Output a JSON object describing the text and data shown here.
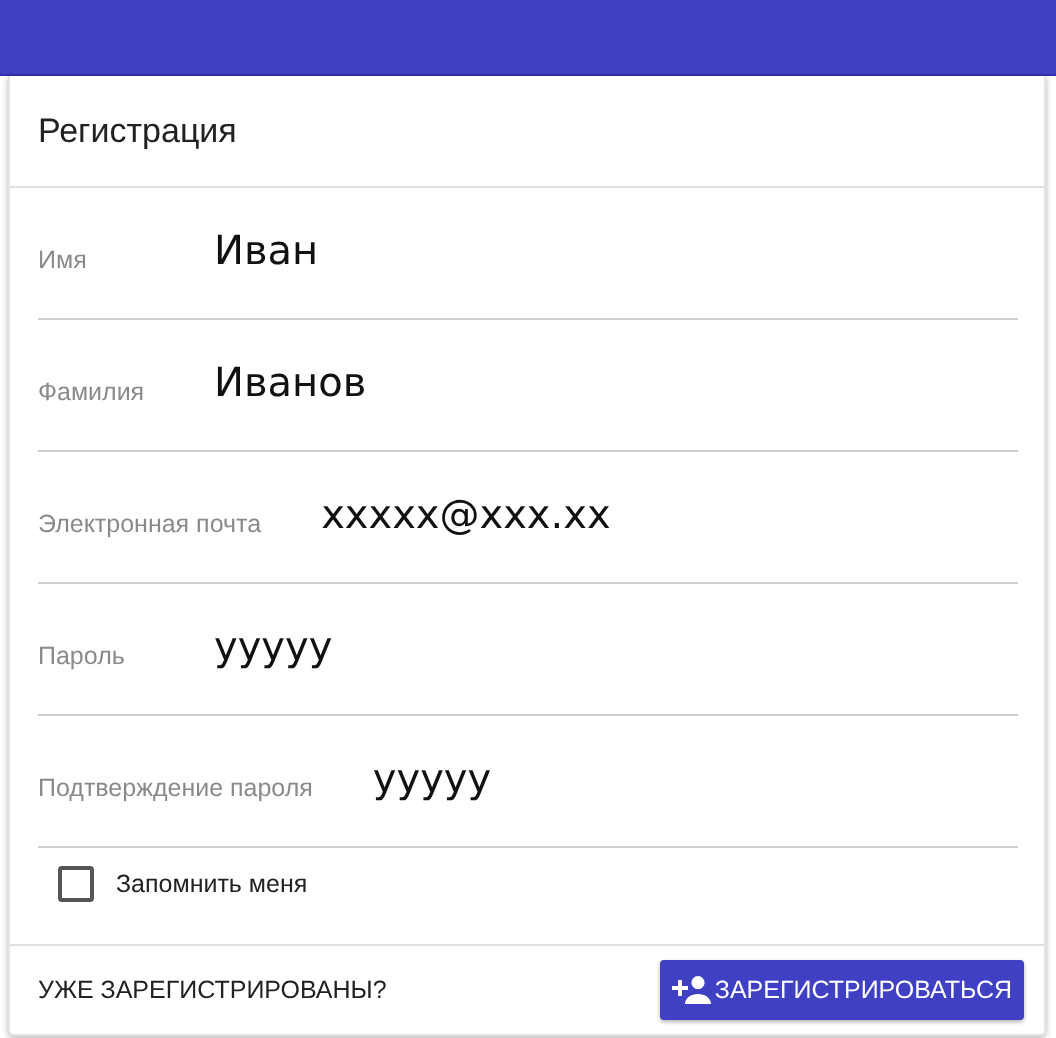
{
  "card": {
    "title": "Регистрация"
  },
  "fields": [
    {
      "label": "Имя",
      "value": "Иван"
    },
    {
      "label": "Фамилия",
      "value": "Иванов"
    },
    {
      "label": "Электронная почта",
      "value": "xxxxx@xxx.xx"
    },
    {
      "label": "Пароль",
      "value": "yyyyy"
    },
    {
      "label": "Подтверждение пароля",
      "value": "yyyyy"
    }
  ],
  "remember": {
    "label": "Запомнить меня",
    "checked": false
  },
  "footer": {
    "link": "УЖЕ ЗАРЕГИСТРИРОВАНЫ?",
    "button": "ЗАРЕГИСТРИРОВАТЬСЯ"
  }
}
